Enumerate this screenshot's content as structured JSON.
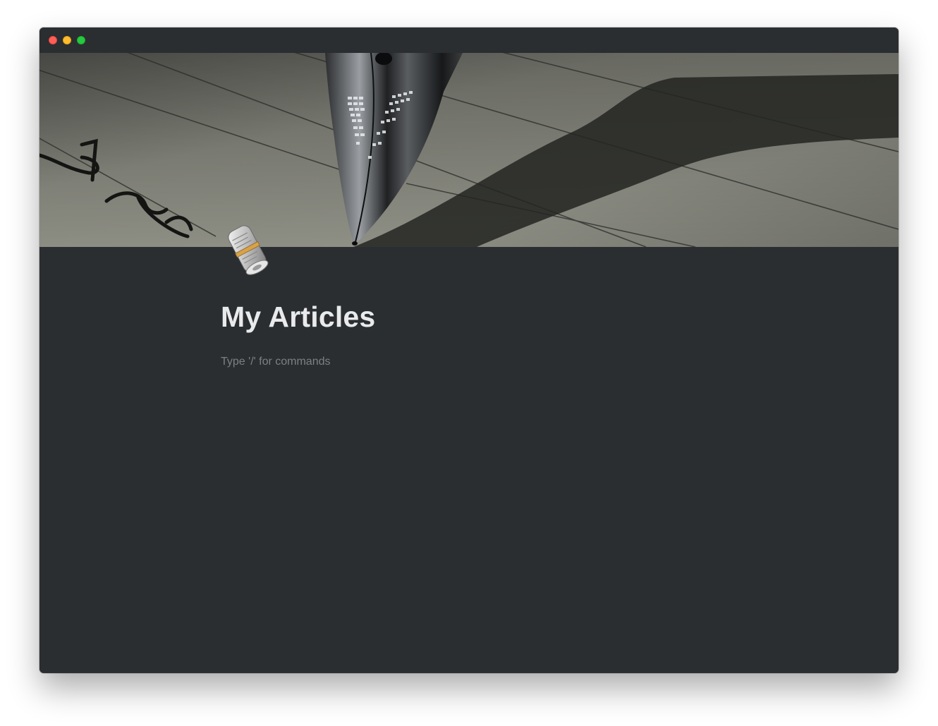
{
  "window": {
    "traffic_lights": {
      "close": "#fe5f57",
      "minimize": "#febc2e",
      "maximize": "#28c840"
    },
    "background": "#2a2e31"
  },
  "cover": {
    "subject": "fountain-pen-nib-on-lined-paper"
  },
  "page": {
    "icon": "newspaper-icon",
    "title": "My Articles",
    "editor_placeholder": "Type '/' for commands"
  }
}
